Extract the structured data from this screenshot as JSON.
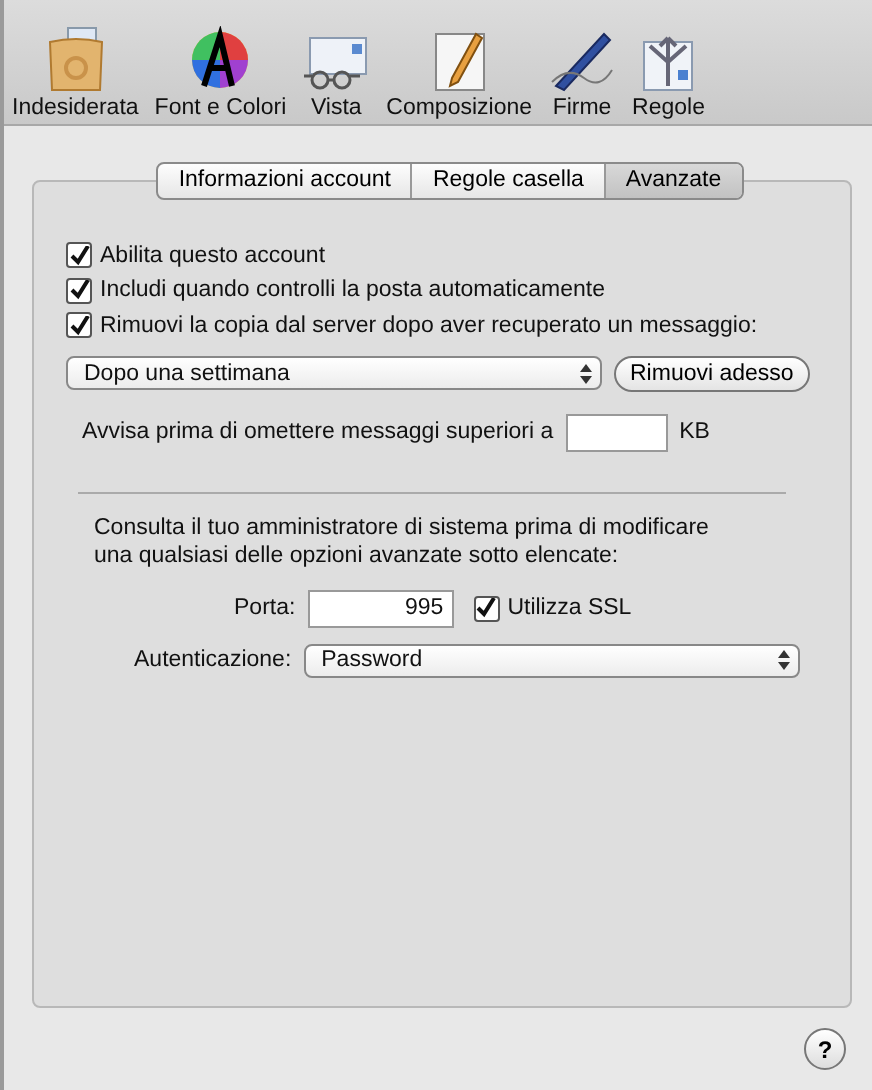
{
  "toolbar": [
    {
      "label": "Indesiderata",
      "kind": "junk"
    },
    {
      "label": "Font e Colori",
      "kind": "fonts"
    },
    {
      "label": "Vista",
      "kind": "viewing"
    },
    {
      "label": "Composizione",
      "kind": "composing"
    },
    {
      "label": "Firme",
      "kind": "signatures"
    },
    {
      "label": "Regole",
      "kind": "rules"
    }
  ],
  "tabs": [
    {
      "label": "Informazioni account",
      "selected": false
    },
    {
      "label": "Regole casella",
      "selected": false
    },
    {
      "label": "Avanzate",
      "selected": true
    }
  ],
  "options": [
    {
      "label": "Abilita questo account",
      "checked": true
    },
    {
      "label": "Includi quando controlli la posta automaticamente",
      "checked": true
    },
    {
      "label": "Rimuovi la copia dal server dopo aver recuperato un messaggio:",
      "checked": true
    }
  ],
  "remove_popup": {
    "value": "Dopo una settimana"
  },
  "remove_button": "Rimuovi adesso",
  "warn": {
    "label": "Avvisa prima di omettere messaggi superiori a",
    "unit": "KB"
  },
  "admin_note": "Consulta il tuo amministratore di sistema prima di modificare una qualsiasi delle opzioni avanzate sotto elencate:",
  "port": {
    "label": "Porta:",
    "value": "995"
  },
  "ssl": {
    "label": "Utilizza SSL",
    "checked": true
  },
  "auth": {
    "label": "Autenticazione:",
    "value": "Password"
  },
  "help": "?"
}
